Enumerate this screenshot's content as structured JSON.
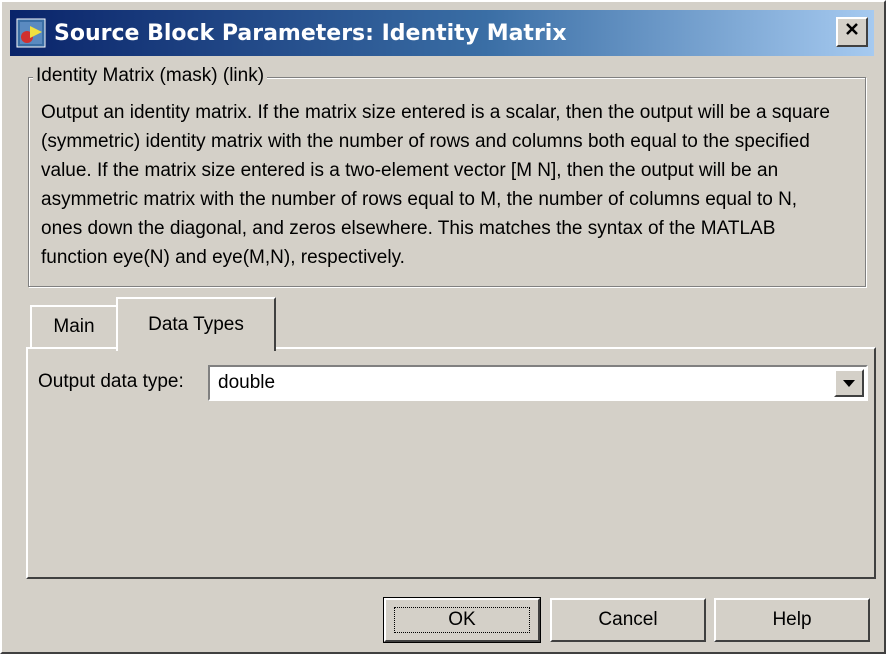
{
  "window": {
    "title": "Source Block Parameters: Identity Matrix",
    "close_symbol": "✕"
  },
  "group": {
    "legend": "Identity Matrix (mask) (link)",
    "description": "Output an identity matrix.  If the matrix size entered is a scalar, then the output will be a square (symmetric) identity matrix with the number of rows and columns both equal to the specified value.  If the matrix size entered is a two-element vector [M N], then the output will be an asymmetric matrix with the number of rows equal to M, the number of columns equal to N, ones down the diagonal, and zeros elsewhere.  This matches the syntax of the MATLAB function eye(N) and eye(M,N), respectively."
  },
  "tabs": [
    {
      "label": "Main",
      "active": false
    },
    {
      "label": "Data Types",
      "active": true
    }
  ],
  "data_types": {
    "output_label": "Output data type:",
    "output_value": "double"
  },
  "buttons": {
    "ok": "OK",
    "cancel": "Cancel",
    "help": "Help"
  },
  "icons": {
    "app": "simulink-block-icon",
    "close": "close-icon",
    "dropdown": "chevron-down-icon"
  },
  "colors": {
    "titlebar_start": "#0a246a",
    "titlebar_end": "#a6caf0",
    "face": "#d4d0c8"
  }
}
